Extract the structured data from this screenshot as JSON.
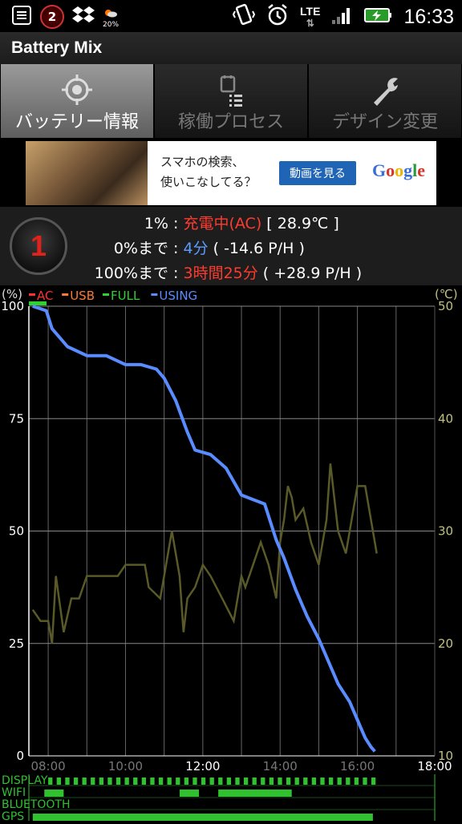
{
  "status_bar": {
    "notification_count": "2",
    "weather_percent": "20%",
    "network": "LTE",
    "time": "16:33",
    "icons": [
      "notification-list-icon",
      "dropbox-icon",
      "weather-icon",
      "vibrate-icon",
      "alarm-icon",
      "signal-icon",
      "battery-charging-icon"
    ]
  },
  "app": {
    "title": "Battery Mix"
  },
  "tabs": [
    {
      "label": "バッテリー情報",
      "icon": "crosshair-icon",
      "active": true
    },
    {
      "label": "稼働プロセス",
      "icon": "process-list-icon",
      "active": false
    },
    {
      "label": "デザイン変更",
      "icon": "wrench-icon",
      "active": false
    }
  ],
  "ad": {
    "line1": "スマホの検索、",
    "line2": "使いこなしてる？",
    "button": "動画を見る",
    "logo": "Google"
  },
  "battery": {
    "level": "1",
    "row1_label": "1%",
    "row1_sep": " : ",
    "row1_status": "充電中(AC)",
    "row1_temp": " [ 28.9℃ ]",
    "row2_label": "0%まで",
    "row2_sep": " : ",
    "row2_value": "4分",
    "row2_rate": " ( -14.6 P/H )",
    "row3_label": "100%まで",
    "row3_sep": " : ",
    "row3_value": "3時間25分",
    "row3_rate": " ( +28.9 P/H )"
  },
  "chart_data": {
    "type": "line",
    "left_unit": "(%)",
    "right_unit": "(℃)",
    "legend": [
      {
        "name": "AC",
        "color": "#ff3030"
      },
      {
        "name": "USB",
        "color": "#ff7a30"
      },
      {
        "name": "FULL",
        "color": "#30d030"
      },
      {
        "name": "USING",
        "color": "#5a8cff"
      }
    ],
    "y_left_ticks": [
      "0",
      "25",
      "50",
      "75",
      "100"
    ],
    "y_right_ticks": [
      "10",
      "20",
      "30",
      "40",
      "50"
    ],
    "x_ticks": [
      "08:00",
      "10:00",
      "12:00",
      "14:00",
      "16:00",
      "18:00"
    ],
    "xlim_hours": [
      7.5,
      18.0
    ],
    "ylim_left": [
      0,
      100
    ],
    "ylim_right": [
      10,
      50
    ],
    "battery_series": {
      "name": "USING",
      "color": "#5a8cff",
      "x": [
        7.6,
        7.95,
        8.1,
        8.5,
        9.0,
        9.5,
        10.0,
        10.4,
        10.8,
        11.0,
        11.3,
        11.6,
        11.8,
        12.2,
        12.6,
        13.0,
        13.3,
        13.6,
        13.9,
        14.1,
        14.4,
        14.7,
        15.0,
        15.3,
        15.5,
        15.8,
        16.0,
        16.2,
        16.35,
        16.45
      ],
      "y": [
        100,
        99,
        95,
        91,
        89,
        89,
        87,
        87,
        86,
        84,
        79,
        72,
        68,
        67,
        64,
        58,
        57,
        56,
        48,
        44,
        37,
        31,
        26,
        20,
        16,
        12,
        8,
        4,
        2,
        1
      ]
    },
    "temperature_series": {
      "color": "#5a5a28",
      "x": [
        7.6,
        7.8,
        8.0,
        8.1,
        8.2,
        8.4,
        8.6,
        8.8,
        9.0,
        9.2,
        9.5,
        9.8,
        10.0,
        10.3,
        10.5,
        10.6,
        10.9,
        11.2,
        11.4,
        11.5,
        11.6,
        11.8,
        12.0,
        12.2,
        12.5,
        12.8,
        13.0,
        13.1,
        13.3,
        13.5,
        13.7,
        13.9,
        14.0,
        14.1,
        14.2,
        14.3,
        14.4,
        14.6,
        14.8,
        15.0,
        15.2,
        15.3,
        15.5,
        15.7,
        15.9,
        16.0,
        16.2,
        16.5
      ],
      "y": [
        23,
        22,
        22,
        20,
        26,
        21,
        24,
        24,
        26,
        26,
        26,
        26,
        27,
        27,
        27,
        25,
        24,
        30,
        26,
        21,
        24,
        25,
        27,
        26,
        24,
        22,
        26,
        25,
        27,
        29,
        27,
        24,
        29,
        31,
        34,
        33,
        31,
        32,
        29,
        27,
        31,
        36,
        30,
        28,
        32,
        34,
        34,
        28
      ]
    },
    "bottom_tracks": [
      {
        "label": "DISPLAY"
      },
      {
        "label": "WIFI"
      },
      {
        "label": "BLUETOOTH"
      },
      {
        "label": "GPS"
      }
    ]
  }
}
